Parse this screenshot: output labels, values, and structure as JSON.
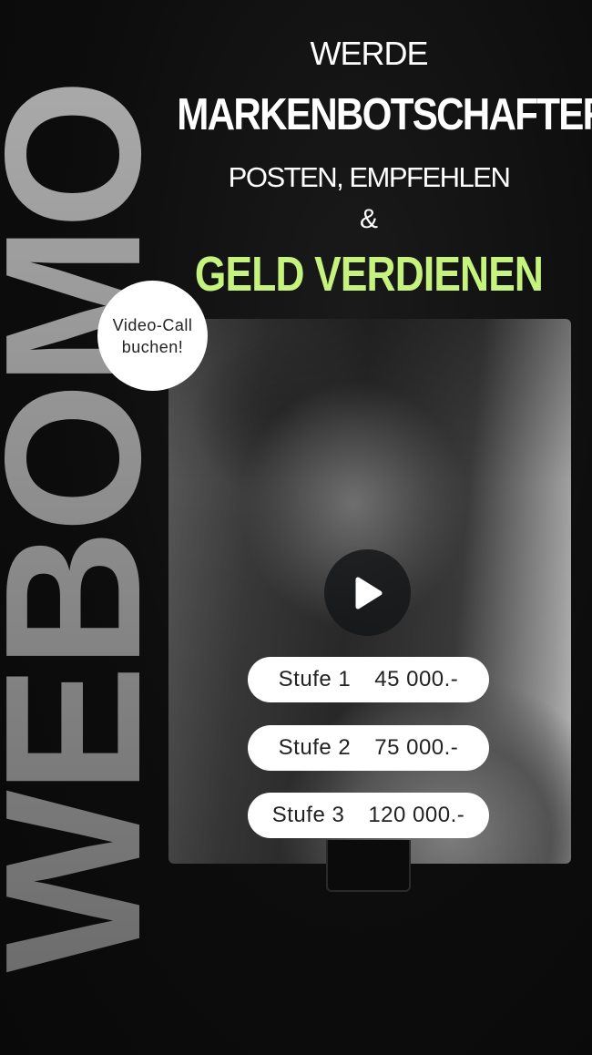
{
  "brand": {
    "wordmark": "WEBOMO"
  },
  "headline": {
    "line1": "WERDE",
    "line2": "MARKENBOTSCHAFTER",
    "line3": "POSTEN, EMPFEHLEN",
    "line4": "&",
    "line5": "GELD VERDIENEN"
  },
  "video_call": {
    "line1": "Video-Call",
    "line2": "buchen!"
  },
  "tiers": [
    {
      "label": "Stufe 1",
      "price": "45 000.-"
    },
    {
      "label": "Stufe 2",
      "price": "75 000.-"
    },
    {
      "label": "Stufe 3",
      "price": "120 000.-"
    }
  ],
  "icons": {
    "play": "play-icon"
  },
  "colors": {
    "accent": "#c6f27e",
    "background": "#0c0c0c",
    "pill": "#ffffff"
  }
}
